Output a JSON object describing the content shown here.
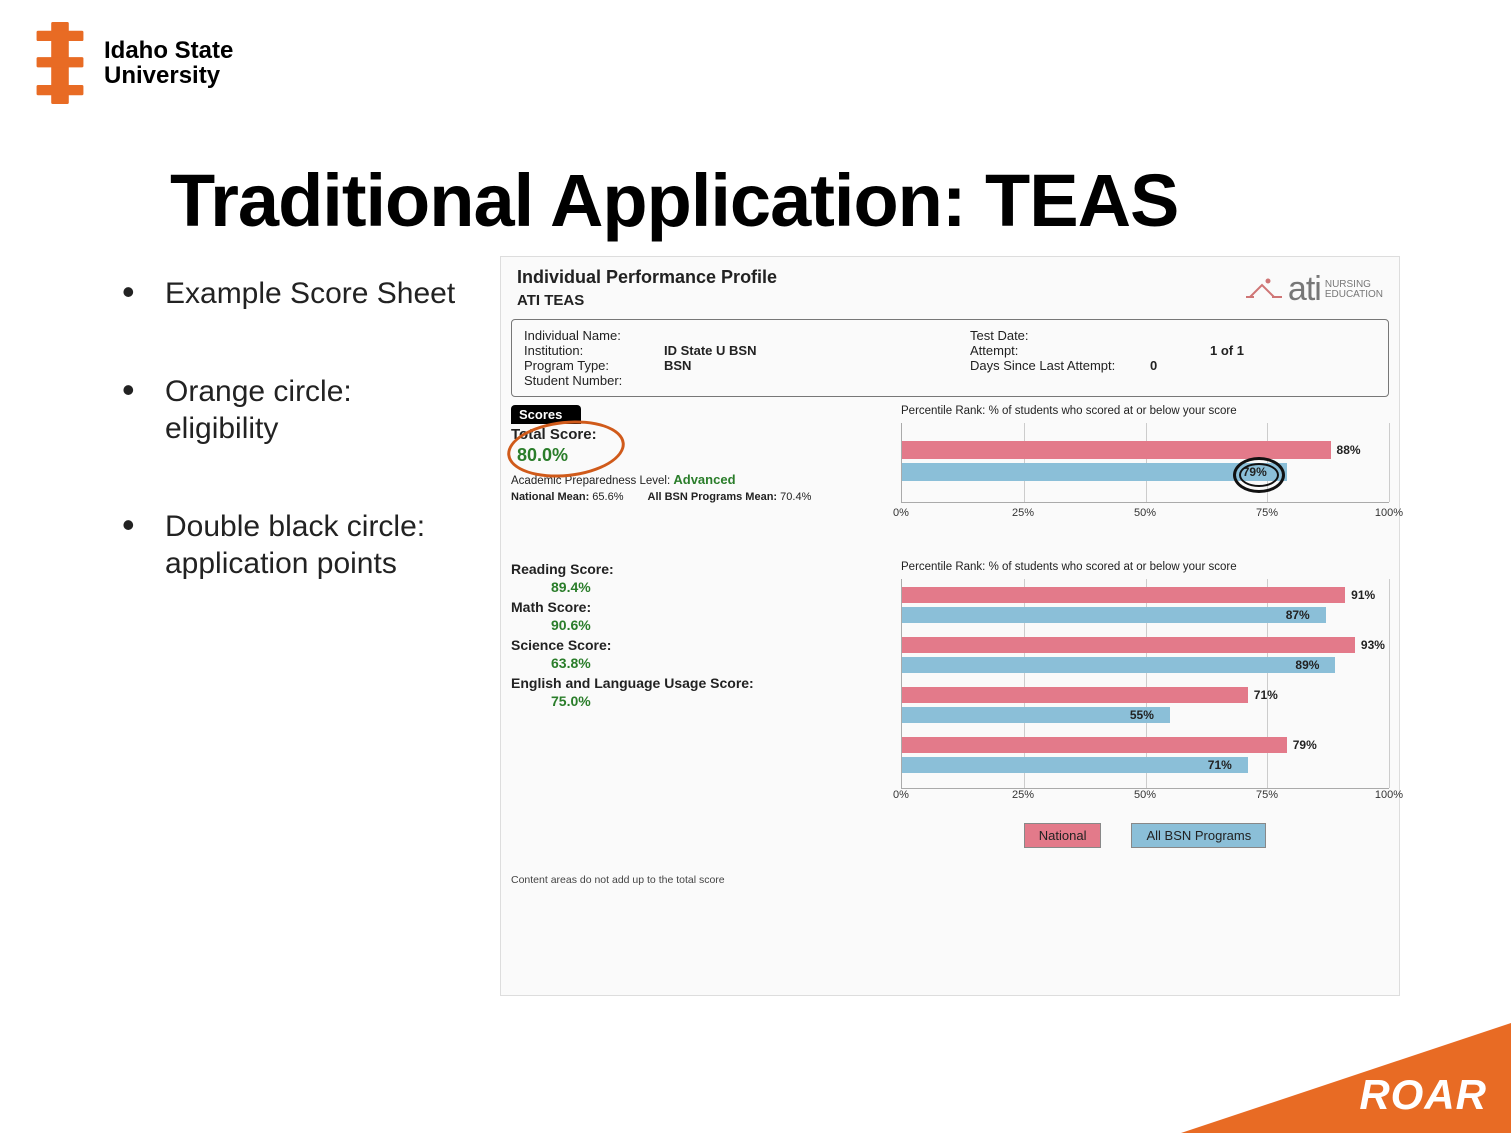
{
  "logo": {
    "line1": "Idaho State",
    "line2": "University"
  },
  "title": "Traditional Application: TEAS",
  "bullets": {
    "b1": "Example Score Sheet",
    "b2": "Orange circle: eligibility",
    "b3": "Double black circle: application points"
  },
  "profile": {
    "heading": "Individual Performance Profile",
    "sub": "ATI TEAS",
    "brand": {
      "name": "ati",
      "tag1": "NURSING",
      "tag2": "EDUCATION"
    },
    "info": {
      "individual_name_lbl": "Individual Name:",
      "institution_lbl": "Institution:",
      "institution_val": "ID State U BSN",
      "program_lbl": "Program Type:",
      "program_val": "BSN",
      "student_no_lbl": "Student Number:",
      "test_date_lbl": "Test Date:",
      "attempt_lbl": "Attempt:",
      "attempt_val": "1 of 1",
      "days_since_lbl": "Days Since Last Attempt:",
      "days_since_val": "0"
    },
    "scores_title": "Scores",
    "total_score_lbl": "Total Score:",
    "total_score_val": "80.0%",
    "prep_lbl": "Academic Preparedness Level:",
    "prep_val": "Advanced",
    "nat_mean_lbl": "National Mean:",
    "nat_mean_val": "65.6%",
    "bsn_mean_lbl": "All BSN Programs Mean:",
    "bsn_mean_val": "70.4%",
    "rank_title": "Percentile Rank: % of students who scored at or below your score",
    "subscores": {
      "reading_lbl": "Reading Score:",
      "reading_val": "89.4%",
      "math_lbl": "Math Score:",
      "math_val": "90.6%",
      "science_lbl": "Science Score:",
      "science_val": "63.8%",
      "english_lbl": "English and Language Usage Score:",
      "english_val": "75.0%"
    },
    "legend": {
      "national": "National",
      "bsn": "All BSN Programs"
    },
    "footnote": "Content areas do not add up to the total score"
  },
  "roar": "ROAR",
  "chart_data": [
    {
      "type": "bar",
      "title": "Percentile Rank: % of students who scored at or below your score (Total)",
      "categories": [
        "Total"
      ],
      "series": [
        {
          "name": "National",
          "values": [
            88
          ]
        },
        {
          "name": "All BSN Programs",
          "values": [
            79
          ]
        }
      ],
      "xlabel": "",
      "ylabel": "",
      "xlim": [
        0,
        100
      ],
      "ticks": [
        "0%",
        "25%",
        "50%",
        "75%",
        "100%"
      ],
      "labels_shown": {
        "National": "88%",
        "All BSN Programs": "79%"
      }
    },
    {
      "type": "bar",
      "title": "Percentile Rank: % of students who scored at or below your score (Sections)",
      "categories": [
        "Reading",
        "Math",
        "Science",
        "English and Language Usage"
      ],
      "series": [
        {
          "name": "National",
          "values": [
            91,
            93,
            71,
            79
          ]
        },
        {
          "name": "All BSN Programs",
          "values": [
            87,
            89,
            55,
            71
          ]
        }
      ],
      "xlabel": "",
      "ylabel": "",
      "xlim": [
        0,
        100
      ],
      "ticks": [
        "0%",
        "25%",
        "50%",
        "75%",
        "100%"
      ]
    }
  ]
}
